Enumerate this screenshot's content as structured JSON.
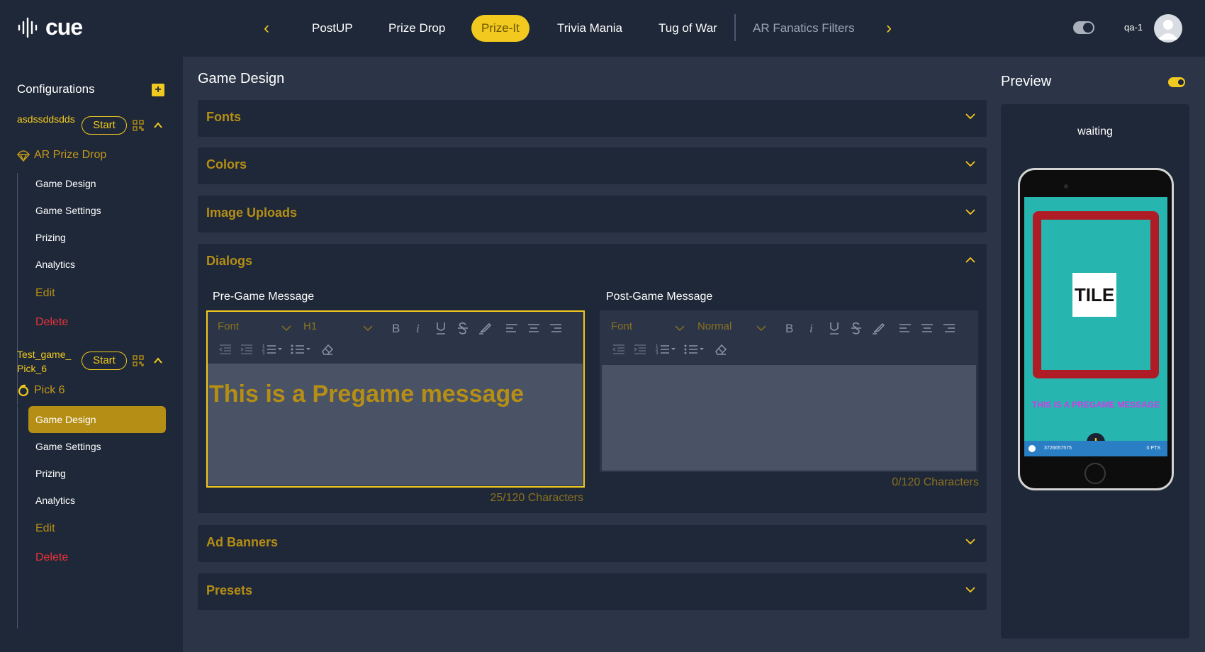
{
  "app": {
    "logo": "cue",
    "user": "qa-1"
  },
  "tabs": [
    {
      "label": "PostUP"
    },
    {
      "label": "Prize Drop"
    },
    {
      "label": "Prize-It"
    },
    {
      "label": "Trivia Mania"
    },
    {
      "label": "Tug of War"
    },
    {
      "label": "AR Fanatics Filters"
    }
  ],
  "sidebar": {
    "title": "Configurations",
    "games": [
      {
        "name": "asdssddsdds",
        "start": "Start",
        "type": "AR Prize Drop",
        "items": [
          "Game Design",
          "Game Settings",
          "Prizing",
          "Analytics",
          "Edit",
          "Delete"
        ]
      },
      {
        "name": "Test_game_Pick_6",
        "start": "Start",
        "type": "Pick 6",
        "items": [
          "Game Design",
          "Game Settings",
          "Prizing",
          "Analytics",
          "Edit",
          "Delete"
        ]
      }
    ]
  },
  "main": {
    "title": "Game Design",
    "sections": [
      "Fonts",
      "Colors",
      "Image Uploads",
      "Dialogs",
      "Ad Banners",
      "Presets"
    ],
    "dialogs": {
      "pre": {
        "label": "Pre-Game Message",
        "font": "Font",
        "size": "H1",
        "text": "This is a Pregame message",
        "count": "25/120 Characters"
      },
      "post": {
        "label": "Post-Game Message",
        "font": "Font",
        "size": "Normal",
        "text": "",
        "count": "0/120 Characters"
      }
    }
  },
  "preview": {
    "title": "Preview",
    "status": "waiting",
    "tile": "TILE",
    "message": "THIS IS A PREGAME MESSAGE",
    "bar_left": "3726657575",
    "bar_right": "0 PTS"
  },
  "colors": {
    "accent": "#f2c91f",
    "danger": "#e8323a",
    "bg": "#1f2838",
    "panel": "#2b3547"
  }
}
